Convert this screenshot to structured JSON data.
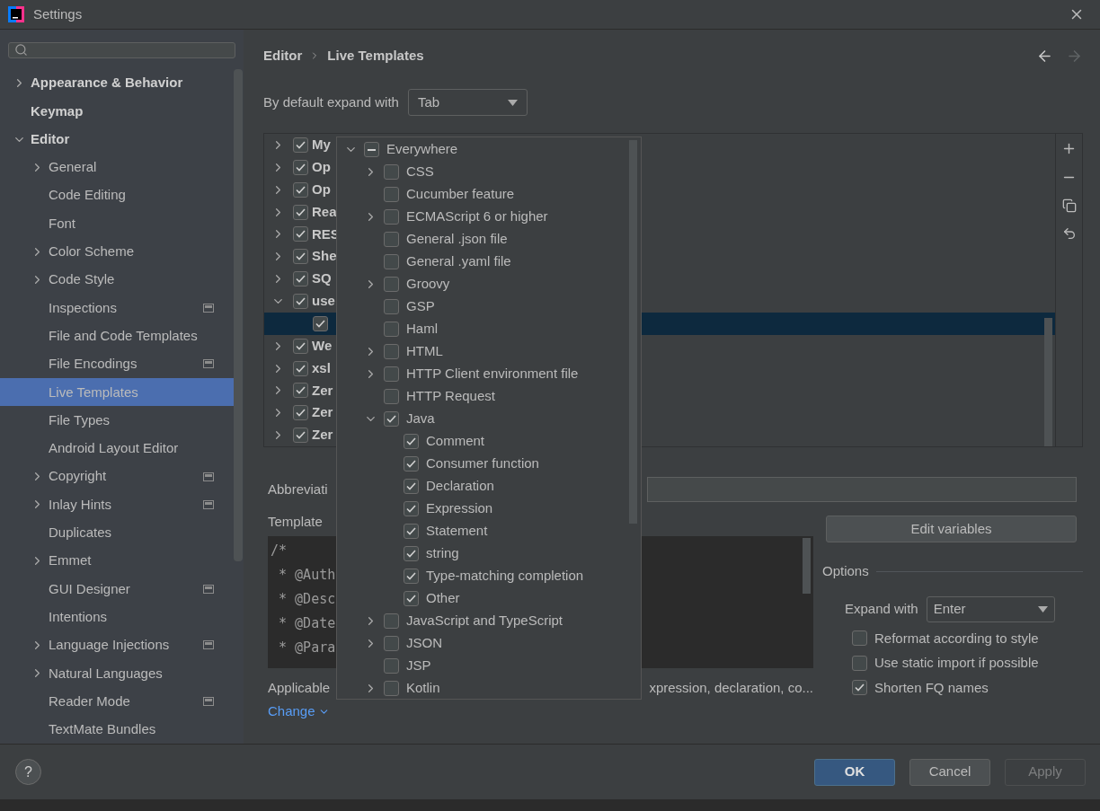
{
  "window": {
    "title": "Settings"
  },
  "sidebar": {
    "items": [
      {
        "label": "Appearance & Behavior",
        "bold": true,
        "expanded": false,
        "selected": false,
        "project_icon": false
      },
      {
        "label": "Keymap",
        "bold": true,
        "selected": false,
        "project_icon": false
      },
      {
        "label": "Editor",
        "bold": true,
        "expanded": true,
        "selected": false,
        "project_icon": false,
        "children": [
          {
            "label": "General",
            "bold": false,
            "expanded": false,
            "selected": false,
            "project_icon": false
          },
          {
            "label": "Code Editing",
            "bold": false,
            "selected": false,
            "project_icon": false
          },
          {
            "label": "Font",
            "bold": false,
            "selected": false,
            "project_icon": false
          },
          {
            "label": "Color Scheme",
            "bold": false,
            "expanded": false,
            "selected": false,
            "project_icon": false
          },
          {
            "label": "Code Style",
            "bold": false,
            "expanded": false,
            "selected": false,
            "project_icon": false
          },
          {
            "label": "Inspections",
            "bold": false,
            "selected": false,
            "project_icon": true
          },
          {
            "label": "File and Code Templates",
            "bold": false,
            "selected": false,
            "project_icon": false
          },
          {
            "label": "File Encodings",
            "bold": false,
            "selected": false,
            "project_icon": true
          },
          {
            "label": "Live Templates",
            "bold": false,
            "selected": true,
            "project_icon": false
          },
          {
            "label": "File Types",
            "bold": false,
            "selected": false,
            "project_icon": false
          },
          {
            "label": "Android Layout Editor",
            "bold": false,
            "selected": false,
            "project_icon": false
          },
          {
            "label": "Copyright",
            "bold": false,
            "expanded": false,
            "selected": false,
            "project_icon": true
          },
          {
            "label": "Inlay Hints",
            "bold": false,
            "expanded": false,
            "selected": false,
            "project_icon": true
          },
          {
            "label": "Duplicates",
            "bold": false,
            "selected": false,
            "project_icon": false
          },
          {
            "label": "Emmet",
            "bold": false,
            "expanded": false,
            "selected": false,
            "project_icon": false
          },
          {
            "label": "GUI Designer",
            "bold": false,
            "selected": false,
            "project_icon": true
          },
          {
            "label": "Intentions",
            "bold": false,
            "selected": false,
            "project_icon": false
          },
          {
            "label": "Language Injections",
            "bold": false,
            "expanded": false,
            "selected": false,
            "project_icon": true
          },
          {
            "label": "Natural Languages",
            "bold": false,
            "expanded": false,
            "selected": false,
            "project_icon": false
          },
          {
            "label": "Reader Mode",
            "bold": false,
            "selected": false,
            "project_icon": true
          },
          {
            "label": "TextMate Bundles",
            "bold": false,
            "selected": false,
            "project_icon": false
          }
        ]
      }
    ]
  },
  "breadcrumb": [
    "Editor",
    "Live Templates"
  ],
  "default_expand": {
    "label": "By default expand with",
    "value": "Tab"
  },
  "template_groups": [
    {
      "name": "My",
      "checked": true,
      "expanded": false,
      "selected": false
    },
    {
      "name": "Op",
      "checked": true,
      "expanded": false,
      "selected": false
    },
    {
      "name": "Op",
      "checked": true,
      "expanded": false,
      "selected": false
    },
    {
      "name": "Rea",
      "checked": true,
      "expanded": false,
      "selected": false
    },
    {
      "name": "RES",
      "checked": true,
      "expanded": false,
      "selected": false
    },
    {
      "name": "She",
      "checked": true,
      "expanded": false,
      "selected": false
    },
    {
      "name": "SQ",
      "checked": true,
      "expanded": false,
      "selected": false
    },
    {
      "name": "use",
      "checked": true,
      "expanded": true,
      "selected": false,
      "children": [
        {
          "checked": true,
          "selected": true
        }
      ]
    },
    {
      "name": "We",
      "checked": true,
      "expanded": false,
      "selected": false
    },
    {
      "name": "xsl",
      "checked": true,
      "expanded": false,
      "selected": false
    },
    {
      "name": "Zer",
      "checked": true,
      "expanded": false,
      "selected": false
    },
    {
      "name": "Zer",
      "checked": true,
      "expanded": false,
      "selected": false
    },
    {
      "name": "Zer",
      "checked": true,
      "expanded": false,
      "selected": false
    }
  ],
  "abbreviation_label": "Abbreviati",
  "template_text_label": "Template",
  "template_text": [
    "/*",
    " * @Auth",
    " * @Desc",
    " * @Date",
    " * @Para"
  ],
  "applicable": {
    "label": "Applicable",
    "rest": "xpression, declaration, co..."
  },
  "change_link": "Change",
  "edit_variables_button": "Edit variables",
  "options": {
    "title": "Options",
    "expand_with": {
      "label": "Expand with",
      "value": "Enter"
    },
    "checkboxes": [
      {
        "label": "Reformat according to style",
        "checked": false
      },
      {
        "label": "Use static import if possible",
        "checked": false
      },
      {
        "label": "Shorten FQ names",
        "checked": true
      }
    ]
  },
  "context_popup": {
    "items": [
      {
        "label": "Everywhere",
        "checked": true,
        "partial": true,
        "expanded": true,
        "children": [
          {
            "label": "CSS",
            "checked": false,
            "expanded": false
          },
          {
            "label": "Cucumber feature",
            "checked": false
          },
          {
            "label": "ECMAScript 6 or higher",
            "checked": false,
            "expanded": false
          },
          {
            "label": "General .json file",
            "checked": false
          },
          {
            "label": "General .yaml file",
            "checked": false
          },
          {
            "label": "Groovy",
            "checked": false,
            "expanded": false
          },
          {
            "label": "GSP",
            "checked": false
          },
          {
            "label": "Haml",
            "checked": false
          },
          {
            "label": "HTML",
            "checked": false,
            "expanded": false
          },
          {
            "label": "HTTP Client environment file",
            "checked": false,
            "expanded": false
          },
          {
            "label": "HTTP Request",
            "checked": false
          },
          {
            "label": "Java",
            "checked": true,
            "expanded": true,
            "children": [
              {
                "label": "Comment",
                "checked": true
              },
              {
                "label": "Consumer function",
                "checked": true
              },
              {
                "label": "Declaration",
                "checked": true
              },
              {
                "label": "Expression",
                "checked": true
              },
              {
                "label": "Statement",
                "checked": true
              },
              {
                "label": "string",
                "checked": true
              },
              {
                "label": "Type-matching completion",
                "checked": true
              },
              {
                "label": "Other",
                "checked": true
              }
            ]
          },
          {
            "label": "JavaScript and TypeScript",
            "checked": false,
            "expanded": false
          },
          {
            "label": "JSON",
            "checked": false,
            "expanded": false
          },
          {
            "label": "JSP",
            "checked": false
          },
          {
            "label": "Kotlin",
            "checked": false,
            "expanded": false
          }
        ]
      }
    ]
  },
  "help_button": "?",
  "buttons": [
    {
      "label": "OK",
      "kind": "primary",
      "disabled": false
    },
    {
      "label": "Cancel",
      "kind": "normal",
      "disabled": false
    },
    {
      "label": "Apply",
      "kind": "normal",
      "disabled": true
    }
  ]
}
